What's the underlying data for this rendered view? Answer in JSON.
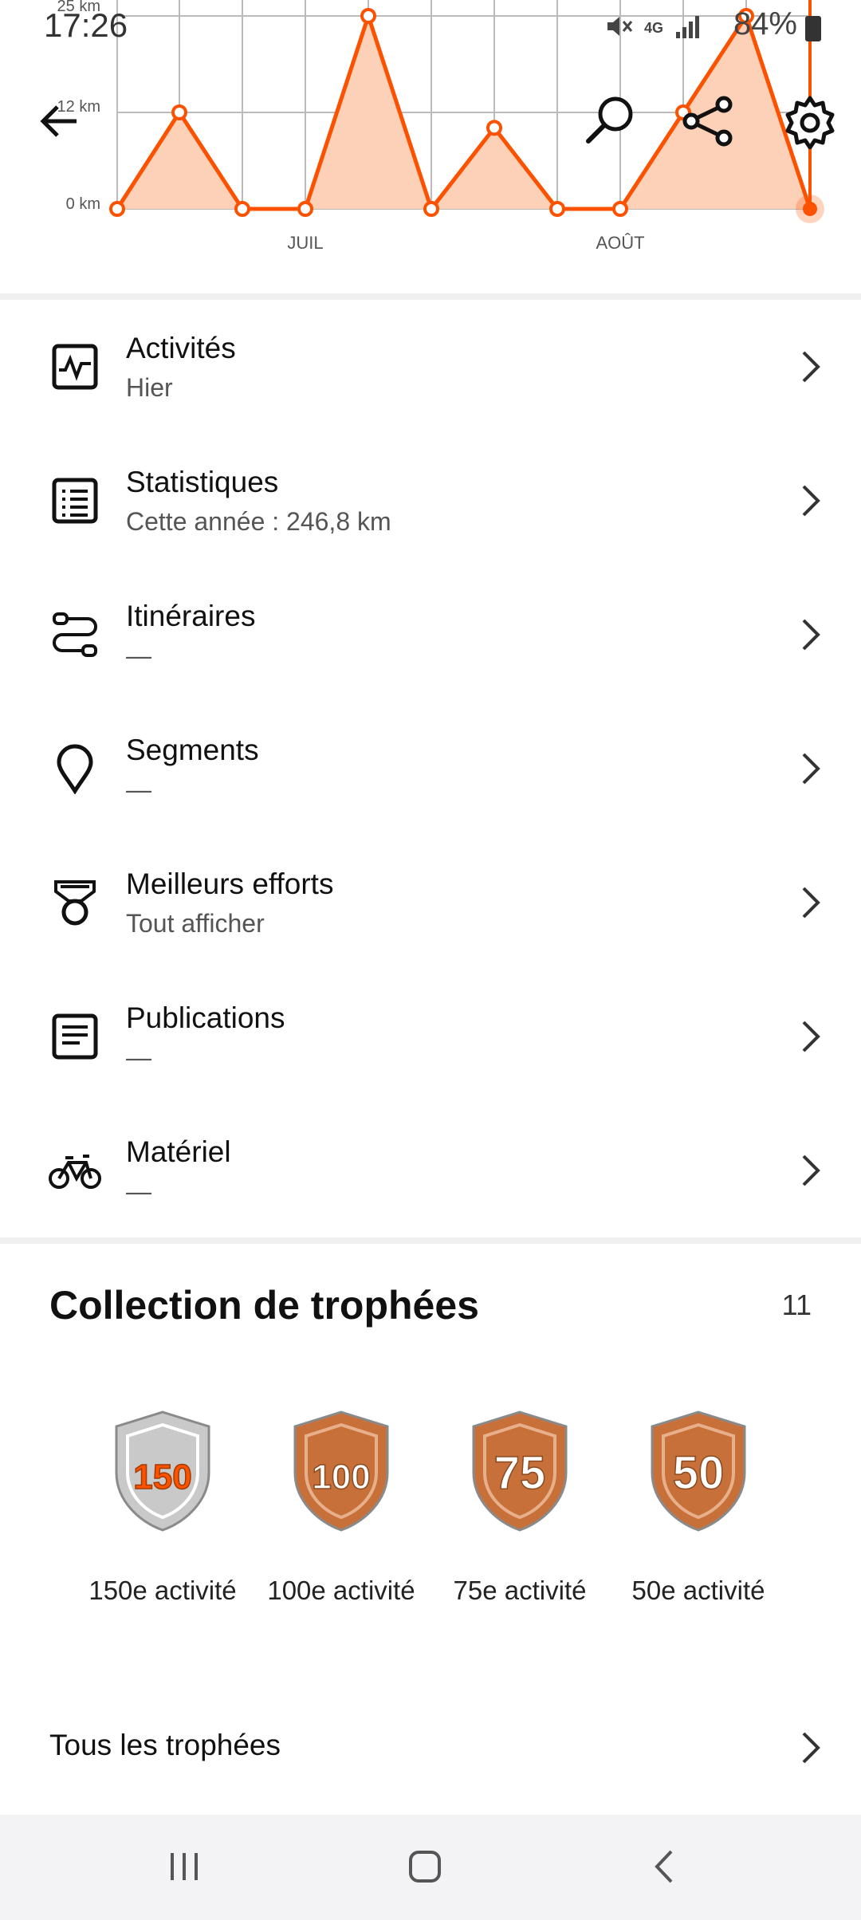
{
  "status_bar": {
    "time": "17:26",
    "battery": "84%",
    "network": "4G",
    "icons": [
      "mute-icon",
      "signal-icon",
      "battery-icon"
    ]
  },
  "header": {
    "icons": [
      "back-arrow-icon",
      "search-icon",
      "share-icon",
      "gear-icon"
    ]
  },
  "chart_data": {
    "type": "area",
    "y_tick_labels": [
      "25 km",
      "12 km",
      "0 km"
    ],
    "x_tick_labels": [
      "JUIL",
      "AOÛT"
    ],
    "ylim": [
      0,
      25
    ],
    "values": [
      0,
      12.5,
      0,
      0,
      25,
      0,
      10.5,
      0,
      0,
      12.5,
      25,
      0
    ],
    "highlight_index": 11,
    "color": "#fc5200",
    "fill_color": "#fdd0b8",
    "grid": true
  },
  "menu": {
    "items": [
      {
        "title": "Activités",
        "subtitle": "Hier",
        "icon": "activity-icon"
      },
      {
        "title": "Statistiques",
        "subtitle": "Cette année : 246,8 km",
        "icon": "stats-icon"
      },
      {
        "title": "Itinéraires",
        "subtitle": "—",
        "icon": "route-icon"
      },
      {
        "title": "Segments",
        "subtitle": "—",
        "icon": "location-pin-icon"
      },
      {
        "title": "Meilleurs efforts",
        "subtitle": "Tout afficher",
        "icon": "medal-icon"
      },
      {
        "title": "Publications",
        "subtitle": "—",
        "icon": "post-icon"
      },
      {
        "title": "Matériel",
        "subtitle": "—",
        "icon": "bike-icon"
      }
    ]
  },
  "trophies": {
    "title": "Collection de trophées",
    "count": "11",
    "items": [
      {
        "badge": "150",
        "label": "150e activité",
        "color": "#c9c9c9",
        "accent": "#fc5200"
      },
      {
        "badge": "100",
        "label": "100e activité",
        "color": "#c8703a",
        "accent": "#ffffff"
      },
      {
        "badge": "75",
        "label": "75e activité",
        "color": "#c8703a",
        "accent": "#ffffff"
      },
      {
        "badge": "50",
        "label": "50e activité",
        "color": "#c8703a",
        "accent": "#ffffff"
      }
    ],
    "all_label": "Tous les trophées"
  },
  "nav": {
    "icons": [
      "recent-apps-icon",
      "home-icon",
      "back-icon"
    ]
  }
}
